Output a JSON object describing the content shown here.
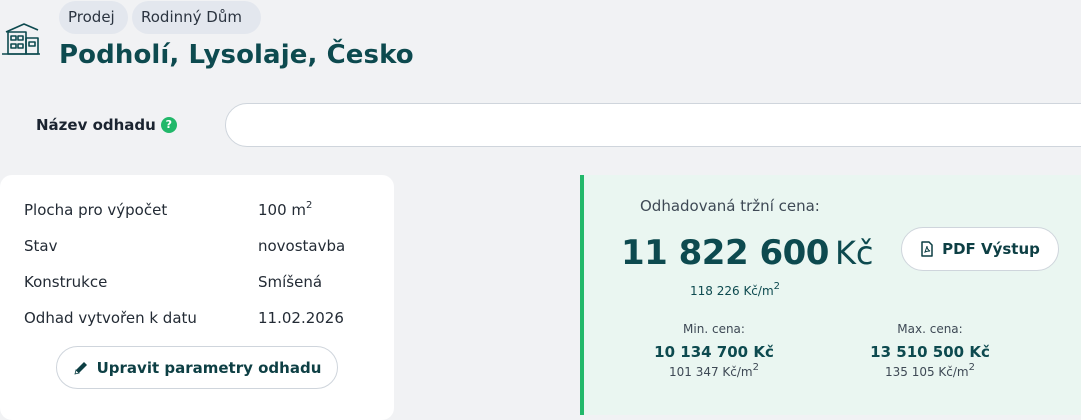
{
  "theme": {
    "accent": "#22b86a",
    "brand": "#0d4a4f",
    "page_bg": "#f1f2f4"
  },
  "tags": [
    "Prodej",
    "Rodinný Dům"
  ],
  "title": "Podholí, Lysolaje, Česko",
  "estimate_name": {
    "label": "Název odhadu",
    "value": "",
    "placeholder": ""
  },
  "params": [
    {
      "label": "Plocha pro výpočet",
      "value": "100 m",
      "sup": "2"
    },
    {
      "label": "Stav",
      "value": "novostavba",
      "sup": ""
    },
    {
      "label": "Konstrukce",
      "value": "Smíšená",
      "sup": ""
    },
    {
      "label": "Odhad vytvořen k datu",
      "value": "11.02.2026",
      "sup": ""
    }
  ],
  "edit_button_label": "Upravit parametry odhadu",
  "price": {
    "label": "Odhadovaná tržní cena:",
    "value": "11 822 600",
    "currency": "Kč",
    "per_sqm": "118 226 Kč/m",
    "per_sqm_sup": "2",
    "min": {
      "label": "Min. cena:",
      "value": "10 134 700 Kč",
      "per_sqm": "101 347 Kč/m",
      "sup": "2"
    },
    "max": {
      "label": "Max. cena:",
      "value": "13 510 500 Kč",
      "per_sqm": "135 105 Kč/m",
      "sup": "2"
    }
  },
  "pdf_button_label": "PDF Výstup",
  "icons": {
    "property": "house-icon",
    "help": "help-icon",
    "edit": "pencil-icon",
    "pdf": "pdf-file-icon"
  }
}
